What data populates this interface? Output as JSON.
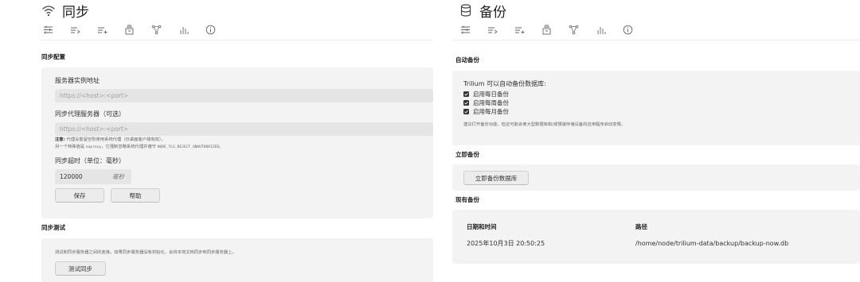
{
  "left": {
    "title": "同步",
    "icon": "wifi-icon",
    "toolbar_icons": [
      "sliders-icon",
      "list-arrow-icon",
      "list-plus-icon",
      "archive-icon",
      "nodes-icon",
      "bar-chart-icon",
      "info-icon"
    ],
    "config_section": "同步配置",
    "server_label": "服务器实例地址",
    "server_placeholder": "https://<host>:<port>",
    "proxy_label": "同步代理服务器（可选）",
    "proxy_placeholder": "https://<host>:<port>",
    "note_prefix": "注意:",
    "note_text": " 代理设置留空则使用系统代理（仅桌面客户端有效）。",
    "note2_a": "另一个特殊值是 ",
    "note2_code1": "noproxy",
    "note2_b": "，它强制忽略系统代理并遵守 ",
    "note2_code2": "NODE_TLS_REJECT_UNAUTHORIZED",
    "note2_c": "。",
    "timeout_label": "同步超时（单位：毫秒）",
    "timeout_value": "120000",
    "timeout_unit": "毫秒",
    "save_label": "保存",
    "help_label": "帮助",
    "test_section": "同步测试",
    "test_desc": "测试和同步服务器之间的连接。如果同步服务器没有初始化，会将本地文档同步到同步服务器上。",
    "test_button": "测试同步"
  },
  "right": {
    "title": "备份",
    "icon": "database-icon",
    "toolbar_icons": [
      "sliders-icon",
      "list-arrow-icon",
      "list-plus-icon",
      "archive-icon",
      "nodes-icon",
      "bar-chart-icon",
      "info-icon"
    ],
    "auto_section": "自动备份",
    "auto_intro": "Trilium 可以自动备份数据库:",
    "daily_label": "启用每日备份",
    "weekly_label": "启用每周备份",
    "monthly_label": "启用每月备份",
    "daily_checked": true,
    "weekly_checked": true,
    "monthly_checked": true,
    "auto_hint": "建议打开备份功能，但这可能会使大型数据库和/或慢速存储设备的应用程序启动变慢。",
    "now_section": "立即备份",
    "now_button": "立即备份数据库",
    "existing_section": "现有备份",
    "col_date": "日期和时间",
    "col_path": "路径",
    "rows": [
      {
        "date": "2025年10月3日 20:50:25",
        "path": "/home/node/trilium-data/backup/backup-now.db"
      }
    ]
  }
}
